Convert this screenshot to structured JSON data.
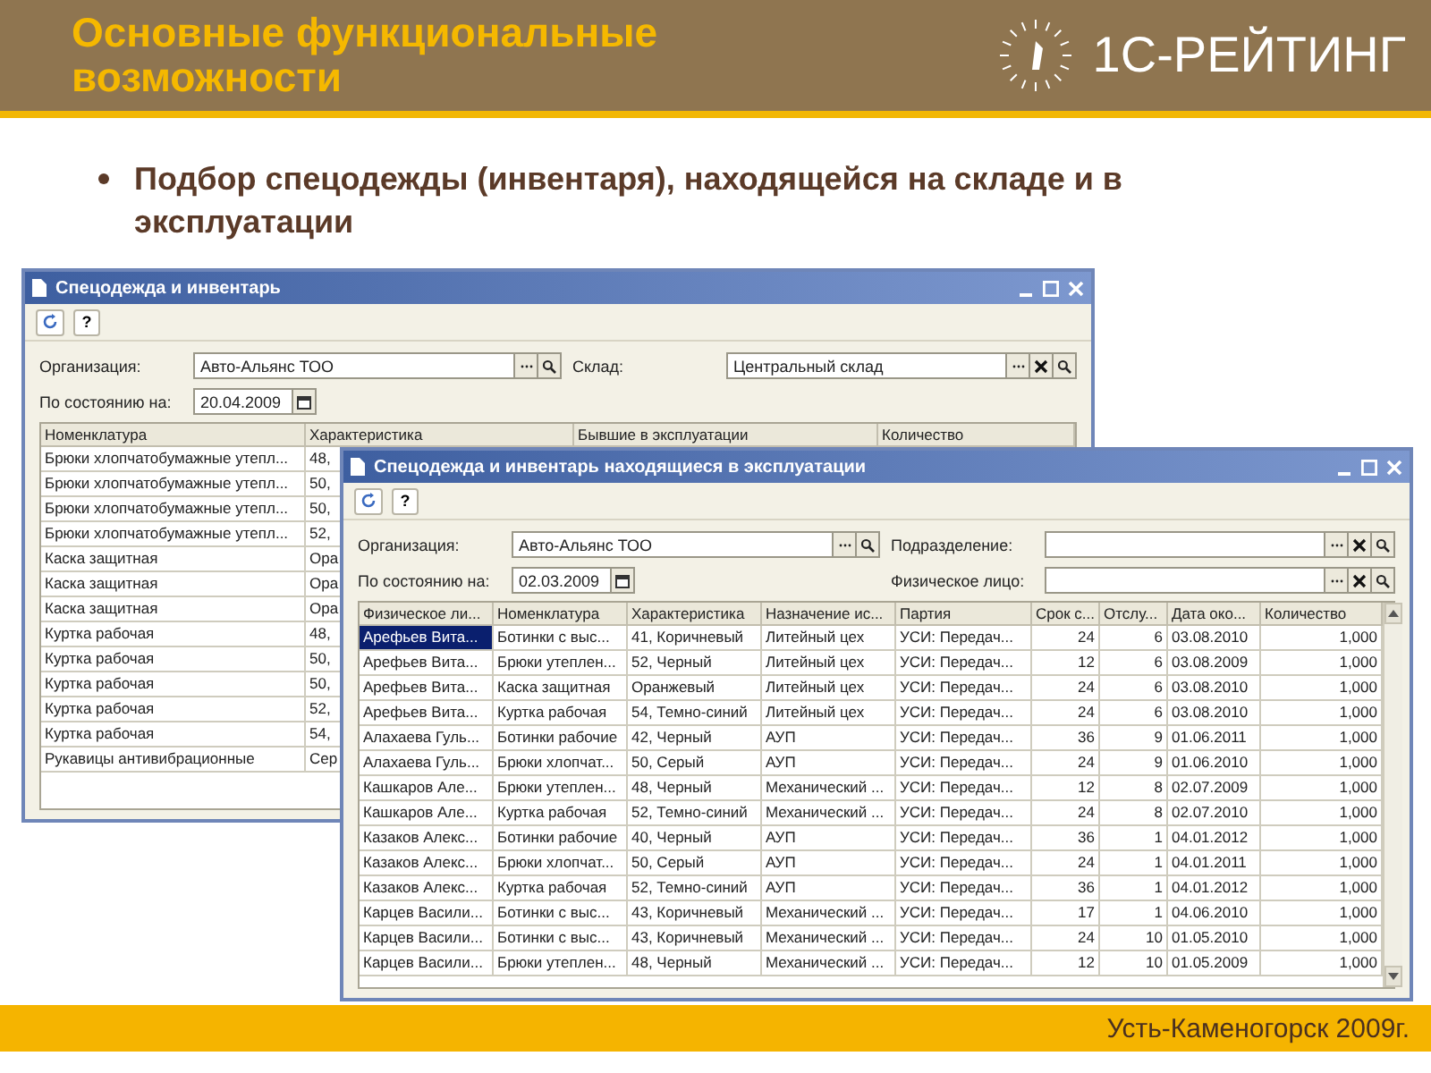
{
  "slide": {
    "title": "Основные функциональные возможности",
    "logo_text": "1С-РЕЙТИНГ",
    "bullets": [
      "Подбор спецодежды (инвентаря), находящейся на складе и в эксплуатации"
    ],
    "footer": "Усть-Каменогорск 2009г."
  },
  "windows": [
    {
      "title": "Спецодежда и инвентарь",
      "help_button": "?",
      "fields": [
        {
          "label": "Организация:",
          "value": "Авто-Альянс ТОО",
          "kind": "reference",
          "clearable": false
        },
        {
          "label": "Склад:",
          "value": "Центральный склад",
          "kind": "reference",
          "clearable": true
        },
        {
          "label": "По состоянию на:",
          "value": "20.04.2009",
          "kind": "date",
          "clearable": false
        }
      ],
      "table": {
        "columns": [
          {
            "label": "Номенклатура"
          },
          {
            "label": "Характеристика"
          },
          {
            "label": "Бывшие в эксплуатации"
          },
          {
            "label": "Количество"
          }
        ],
        "rows": [
          {
            "selected": false,
            "cells": [
              "Брюки хлопчатобумажные утепл...",
              "48,"
            ]
          },
          {
            "selected": false,
            "cells": [
              "Брюки хлопчатобумажные утепл...",
              "50,"
            ]
          },
          {
            "selected": false,
            "cells": [
              "Брюки хлопчатобумажные утепл...",
              "50,"
            ]
          },
          {
            "selected": false,
            "cells": [
              "Брюки хлопчатобумажные утепл...",
              "52,"
            ]
          },
          {
            "selected": false,
            "cells": [
              "Каска защитная",
              "Ора"
            ]
          },
          {
            "selected": false,
            "cells": [
              "Каска защитная",
              "Ора"
            ]
          },
          {
            "selected": false,
            "cells": [
              "Каска защитная",
              "Ора"
            ]
          },
          {
            "selected": false,
            "cells": [
              "Куртка рабочая",
              "48,"
            ]
          },
          {
            "selected": false,
            "cells": [
              "Куртка рабочая",
              "50,"
            ]
          },
          {
            "selected": false,
            "cells": [
              "Куртка рабочая",
              "50,"
            ]
          },
          {
            "selected": false,
            "cells": [
              "Куртка рабочая",
              "52,"
            ]
          },
          {
            "selected": false,
            "cells": [
              "Куртка рабочая",
              "54,"
            ]
          },
          {
            "selected": false,
            "cells": [
              "Рукавицы антивибрационные",
              "Сер"
            ]
          }
        ]
      }
    },
    {
      "title": "Спецодежда и инвентарь находящиеся в эксплуатации",
      "help_button": "?",
      "fields": [
        {
          "label": "Организация:",
          "value": "Авто-Альянс ТОО",
          "kind": "reference",
          "clearable": false
        },
        {
          "label": "Подразделение:",
          "kind": "reference",
          "clearable": true
        },
        {
          "label": "По состоянию на:",
          "value": "02.03.2009",
          "kind": "date",
          "clearable": false
        },
        {
          "label": "Физическое лицо:",
          "kind": "reference",
          "clearable": true
        }
      ],
      "table": {
        "columns": [
          {
            "label": "Физическое ли...",
            "kind": "text"
          },
          {
            "label": "Номенклатура",
            "kind": "text"
          },
          {
            "label": "Характеристика",
            "kind": "text"
          },
          {
            "label": "Назначение ис...",
            "kind": "text"
          },
          {
            "label": "Партия",
            "kind": "text"
          },
          {
            "label": "Срок с...",
            "kind": "number"
          },
          {
            "label": "Отслу...",
            "kind": "number"
          },
          {
            "label": "Дата око...",
            "kind": "text"
          },
          {
            "label": "Количество",
            "kind": "number"
          }
        ],
        "rows": [
          {
            "selected": true,
            "cells": [
              "Арефьев Вита...",
              "Ботинки с выс...",
              "41, Коричневый",
              "Литейный цех",
              "УСИ: Передач...",
              "24",
              "6",
              "03.08.2010",
              "1,000"
            ]
          },
          {
            "selected": false,
            "cells": [
              "Арефьев Вита...",
              "Брюки утеплен...",
              "52, Черный",
              "Литейный цех",
              "УСИ: Передач...",
              "12",
              "6",
              "03.08.2009",
              "1,000"
            ]
          },
          {
            "selected": false,
            "cells": [
              "Арефьев Вита...",
              "Каска защитная",
              "Оранжевый",
              "Литейный цех",
              "УСИ: Передач...",
              "24",
              "6",
              "03.08.2010",
              "1,000"
            ]
          },
          {
            "selected": false,
            "cells": [
              "Арефьев Вита...",
              "Куртка рабочая",
              "54, Темно-синий",
              "Литейный цех",
              "УСИ: Передач...",
              "24",
              "6",
              "03.08.2010",
              "1,000"
            ]
          },
          {
            "selected": false,
            "cells": [
              "Алахаева Гуль...",
              "Ботинки рабочие",
              "42, Черный",
              "АУП",
              "УСИ: Передач...",
              "36",
              "9",
              "01.06.2011",
              "1,000"
            ]
          },
          {
            "selected": false,
            "cells": [
              "Алахаева Гуль...",
              "Брюки хлопчат...",
              "50, Серый",
              "АУП",
              "УСИ: Передач...",
              "24",
              "9",
              "01.06.2010",
              "1,000"
            ]
          },
          {
            "selected": false,
            "cells": [
              "Кашкаров Але...",
              "Брюки утеплен...",
              "48, Черный",
              "Механический ...",
              "УСИ: Передач...",
              "12",
              "8",
              "02.07.2009",
              "1,000"
            ]
          },
          {
            "selected": false,
            "cells": [
              "Кашкаров Але...",
              "Куртка рабочая",
              "52, Темно-синий",
              "Механический ...",
              "УСИ: Передач...",
              "24",
              "8",
              "02.07.2010",
              "1,000"
            ]
          },
          {
            "selected": false,
            "cells": [
              "Казаков Алекс...",
              "Ботинки рабочие",
              "40, Черный",
              "АУП",
              "УСИ: Передач...",
              "36",
              "1",
              "04.01.2012",
              "1,000"
            ]
          },
          {
            "selected": false,
            "cells": [
              "Казаков Алекс...",
              "Брюки хлопчат...",
              "50, Серый",
              "АУП",
              "УСИ: Передач...",
              "24",
              "1",
              "04.01.2011",
              "1,000"
            ]
          },
          {
            "selected": false,
            "cells": [
              "Казаков Алекс...",
              "Куртка рабочая",
              "52, Темно-синий",
              "АУП",
              "УСИ: Передач...",
              "36",
              "1",
              "04.01.2012",
              "1,000"
            ]
          },
          {
            "selected": false,
            "cells": [
              "Карцев Васили...",
              "Ботинки с выс...",
              "43, Коричневый",
              "Механический ...",
              "УСИ: Передач...",
              "17",
              "1",
              "04.06.2010",
              "1,000"
            ]
          },
          {
            "selected": false,
            "cells": [
              "Карцев Васили...",
              "Ботинки с выс...",
              "43, Коричневый",
              "Механический ...",
              "УСИ: Передач...",
              "24",
              "10",
              "01.05.2010",
              "1,000"
            ]
          },
          {
            "selected": false,
            "cells": [
              "Карцев Васили...",
              "Брюки утеплен...",
              "48, Черный",
              "Механический ...",
              "УСИ: Передач...",
              "12",
              "10",
              "01.05.2009",
              "1,000"
            ]
          }
        ]
      }
    }
  ]
}
